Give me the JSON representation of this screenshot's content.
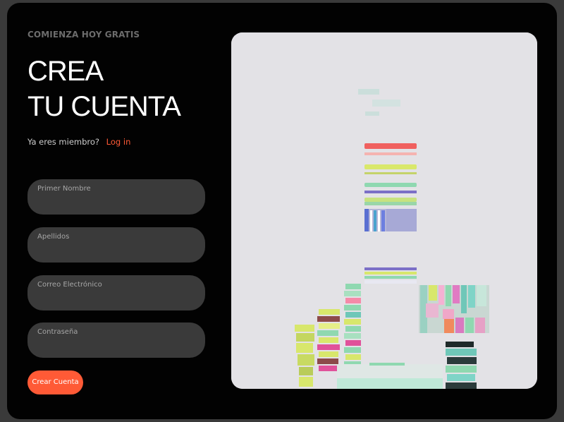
{
  "signup": {
    "eyebrow": "COMIENZA HOY GRATIS",
    "title_line1": "CREA",
    "title_line2": "TU CUENTA",
    "member_text": "Ya eres miembro?",
    "login_link": "Log in",
    "fields": [
      {
        "placeholder": "Primer Nombre",
        "value": ""
      },
      {
        "placeholder": "Apellidos",
        "value": ""
      },
      {
        "placeholder": "Correo Electrónico",
        "value": ""
      },
      {
        "placeholder": "Contraseña",
        "value": ""
      }
    ],
    "submit_label": "Crear Cuenta"
  },
  "colors": {
    "background": "#020202",
    "accent": "#ff5a36",
    "field_bg": "#3a3a3a",
    "illustration_bg": "#e3e2e6"
  }
}
